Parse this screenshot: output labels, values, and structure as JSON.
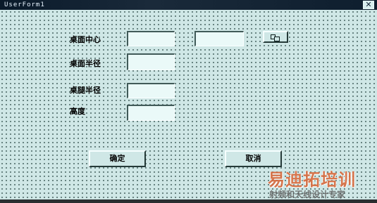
{
  "window": {
    "title": "UserForm1",
    "close_symbol": "✕"
  },
  "form": {
    "labels": {
      "desk_center": "桌面中心",
      "desk_radius": "桌面半径",
      "leg_radius": "桌腿半径",
      "height": "高度"
    },
    "fields": {
      "desk_center_x": "",
      "desk_center_y": "",
      "desk_radius": "",
      "leg_radius": "",
      "height": ""
    },
    "pick_button_icon": "pick-point-icon",
    "ok_label": "确定",
    "cancel_label": "取消"
  },
  "watermark": {
    "main": "易迪拓培训",
    "sub": "射频和天线设计专家"
  }
}
